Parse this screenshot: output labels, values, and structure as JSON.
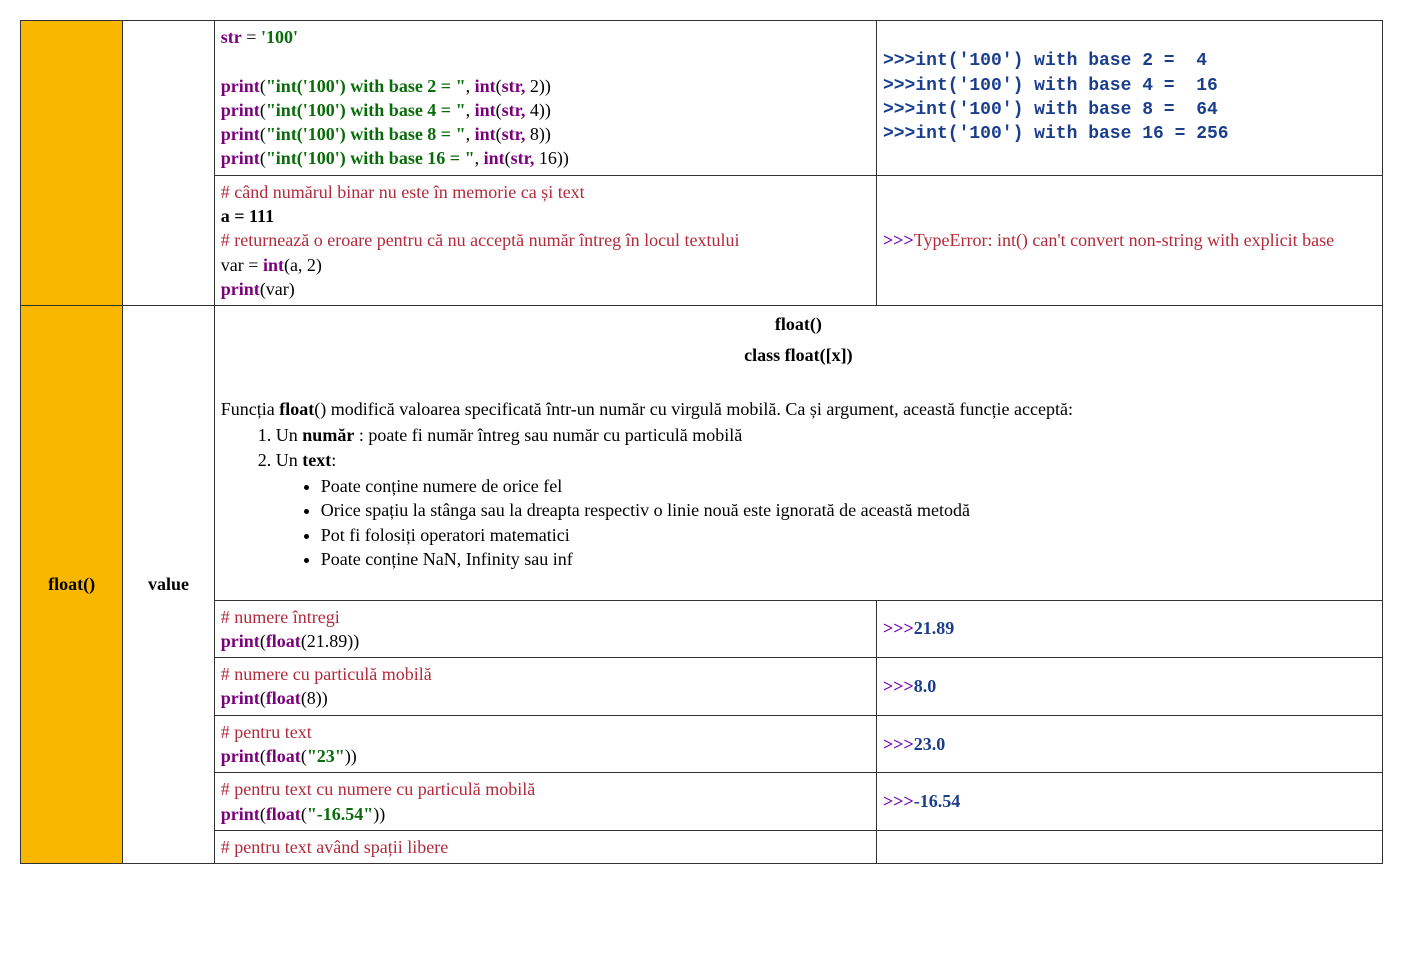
{
  "row1": {
    "code": {
      "l1a": "str",
      "l1b": " = ",
      "l1c": "'100'",
      "l2a": "print",
      "l2p": "(",
      "l2s": "\"int('100') with base 2 = \"",
      "l2c": ", ",
      "l2i": "int",
      "l2o": "(",
      "l2v": "str,",
      "l2n": " 2))",
      "l3a": "print",
      "l3p": "(",
      "l3s": "\"int('100') with base 4 = \"",
      "l3c": ", ",
      "l3i": "int",
      "l3o": "(",
      "l3v": "str,",
      "l3n": " 4))",
      "l4a": "print",
      "l4p": "(",
      "l4s": "\"int('100') with base 8 = \"",
      "l4c": ", ",
      "l4i": "int",
      "l4o": "(",
      "l4v": "str,",
      "l4n": " 8))",
      "l5a": "print",
      "l5p": "(",
      "l5s": "\"int('100') with base 16 = \"",
      "l5c": ", ",
      "l5i": "int",
      "l5o": "(",
      "l5v": "str,",
      "l5n": " 16))"
    },
    "out": {
      "p": ">>>",
      "o1": "int('100') with base 2 =  4",
      "o2": "int('100') with base 4 =  16",
      "o3": "int('100') with base 8 =  64",
      "o4": "int('100') with base 16 = 256"
    }
  },
  "row2": {
    "code": {
      "c1": "# când numărul binar nu este în memorie ca și text",
      "a1": "a = 111",
      "c2": "# returnează o eroare pentru că nu acceptă număr întreg în locul textului",
      "v1a": "var = ",
      "v1b": "int",
      "v1c": "(a, 2)",
      "p1a": "print",
      "p1b": "(var)"
    },
    "out": {
      "p": ">>>",
      "err": "TypeError: int() can't convert non-string with explicit base"
    }
  },
  "float": {
    "fname": "float()",
    "arg": "value",
    "hdr1": "float()",
    "hdr2": "class float([x])",
    "intro1": "Funcția ",
    "intro2": "float",
    "intro3": "() modifică valoarea specificată într-un număr cu virgulă mobilă. Ca și argument, această funcție acceptă:",
    "li1a": "Un ",
    "li1b": "număr",
    "li1c": " : poate fi număr întreg sau număr cu particulă mobilă",
    "li2a": "Un ",
    "li2b": "text",
    "li2c": ":",
    "s1": "Poate conține numere de orice fel",
    "s2": "Orice spațiu la stânga sau la dreapta respectiv o linie nouă este ignorată de această metodă",
    "s3": "Pot fi folosiți operatori matematici",
    "s4": "Poate conține NaN, Infinity sau inf"
  },
  "ex1": {
    "c": "# numere întregi",
    "p": "print",
    "o": "(",
    "f": "float",
    "a": "(21.89))",
    "prompt": ">>>",
    "out": "21.89"
  },
  "ex2": {
    "c": "# numere cu particulă mobilă",
    "p": "print",
    "o": "(",
    "f": "float",
    "a": "(8))",
    "prompt": ">>>",
    "out": "8.0"
  },
  "ex3": {
    "c": "# pentru text",
    "p": "print",
    "o": "(",
    "f": "float",
    "op": "(",
    "s": "\"23\"",
    "cp": "))",
    "prompt": ">>>",
    "out": "23.0"
  },
  "ex4": {
    "c": "# pentru text cu numere cu particulă mobilă",
    "p": "print",
    "o": "(",
    "f": "float",
    "op": "(",
    "s": "\"-16.54\"",
    "cp": "))",
    "prompt": ">>>",
    "out": "-16.54"
  },
  "ex5": {
    "c": "# pentru text având spații libere"
  }
}
